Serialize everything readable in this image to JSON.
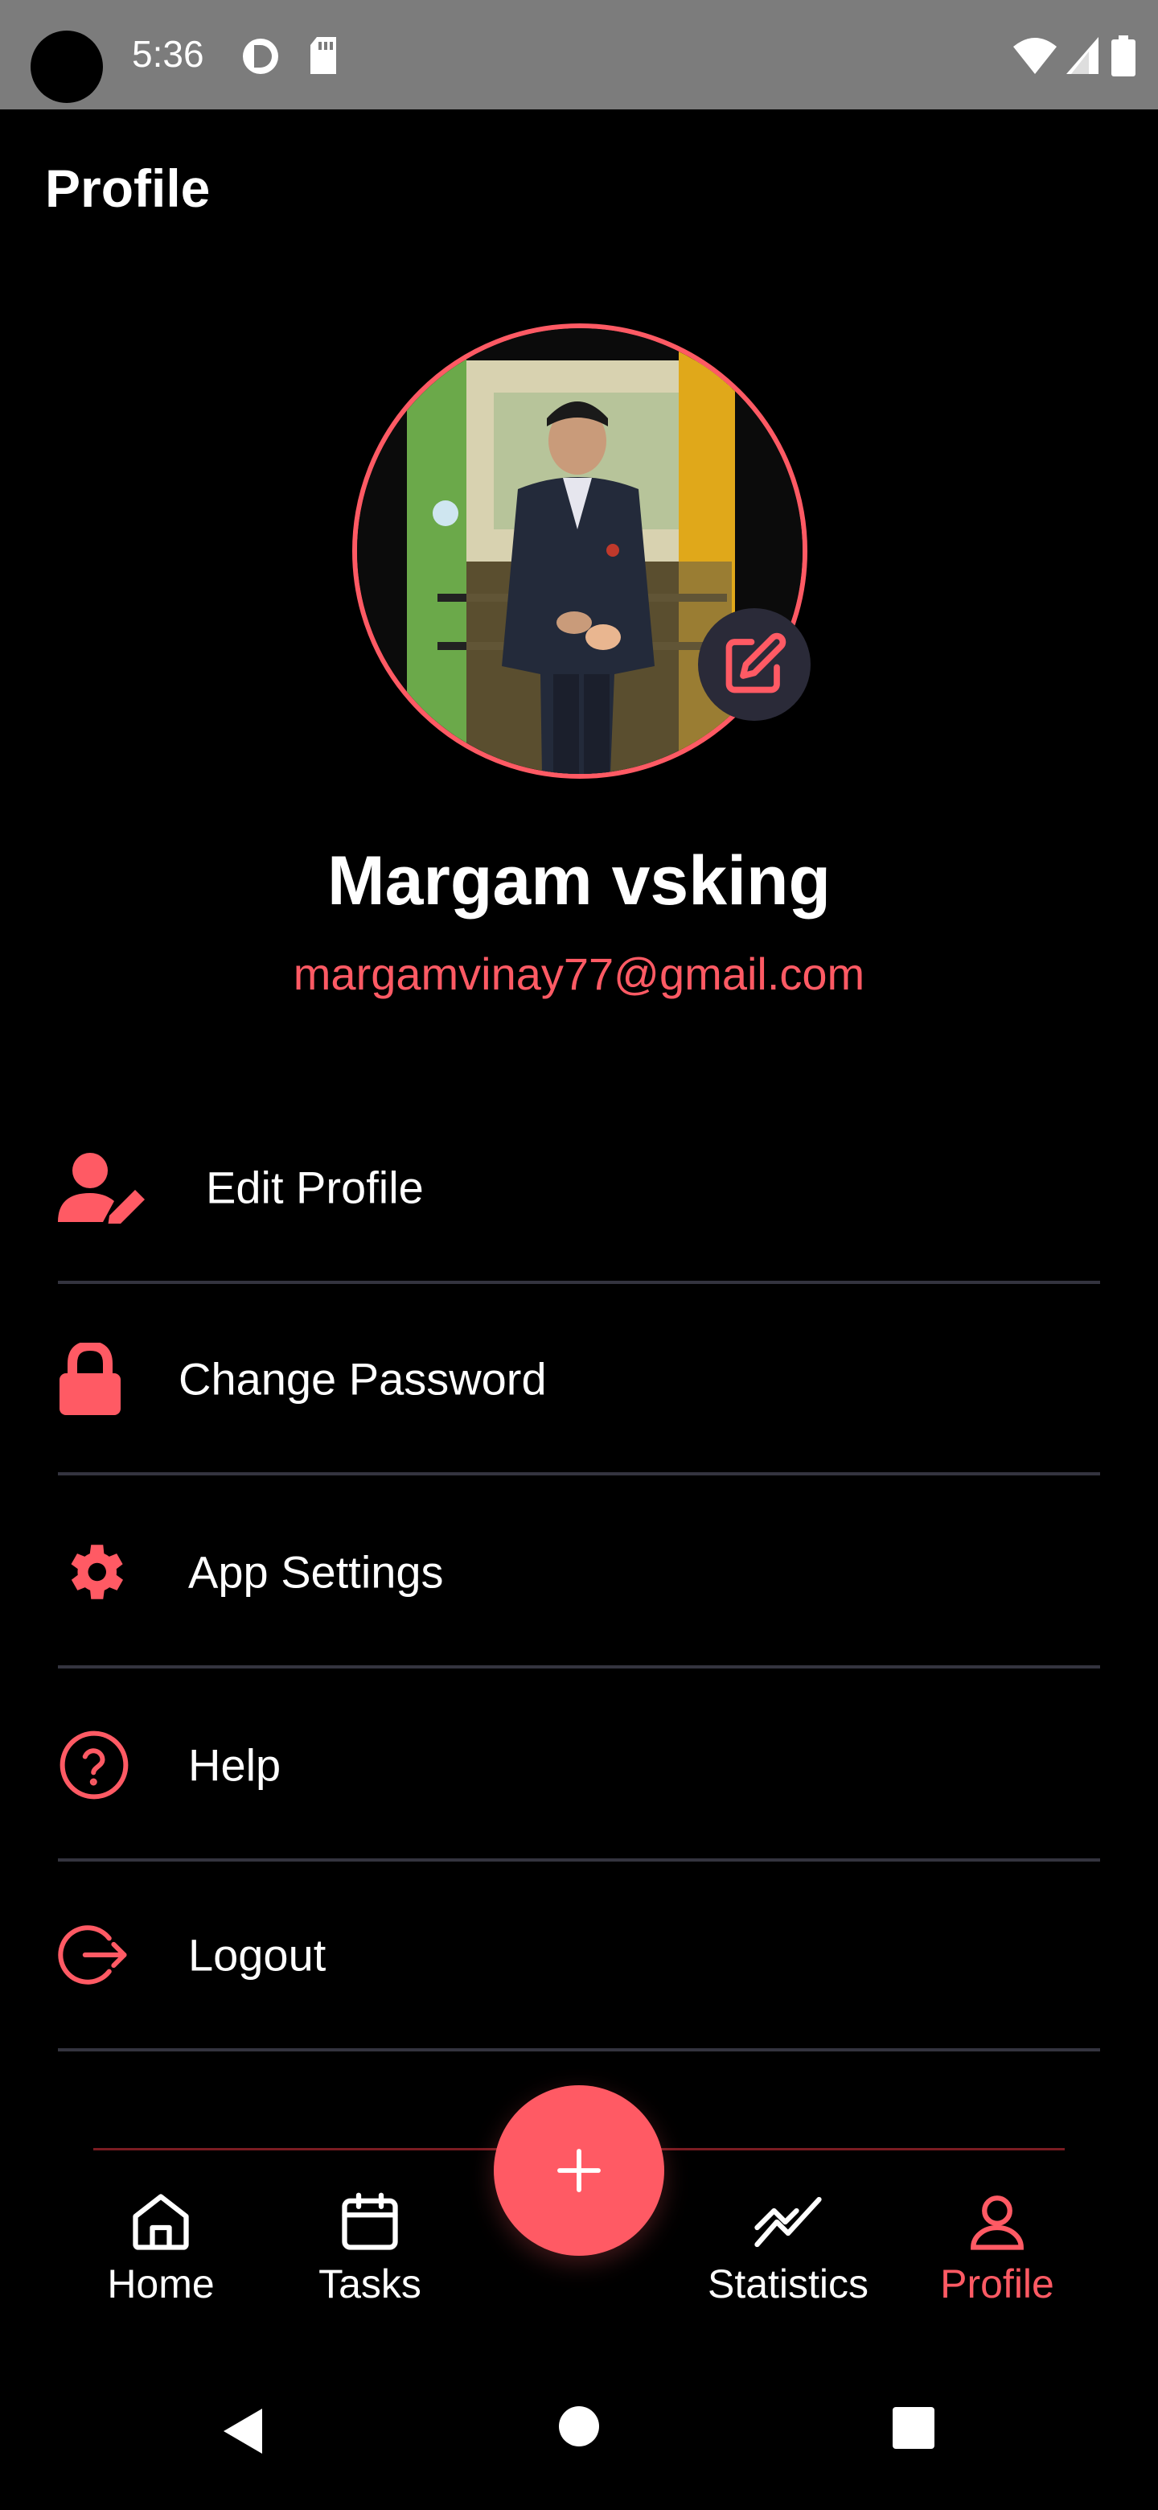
{
  "status_bar": {
    "time": "5:36"
  },
  "header": {
    "title": "Profile"
  },
  "profile": {
    "name": "Margam vsking",
    "email": "margamvinay77@gmail.com"
  },
  "menu": {
    "items": [
      {
        "label": "Edit Profile",
        "icon": "user-edit-icon"
      },
      {
        "label": "Change Password",
        "icon": "lock-icon"
      },
      {
        "label": "App Settings",
        "icon": "gear-icon"
      },
      {
        "label": "Help",
        "icon": "help-circle-icon"
      },
      {
        "label": "Logout",
        "icon": "logout-icon"
      }
    ]
  },
  "bottom_nav": {
    "items": [
      {
        "label": "Home",
        "icon": "home-icon",
        "active": false
      },
      {
        "label": "Tasks",
        "icon": "calendar-icon",
        "active": false
      },
      {
        "label": "Statistics",
        "icon": "chart-line-icon",
        "active": false
      },
      {
        "label": "Profile",
        "icon": "user-icon",
        "active": true
      }
    ],
    "fab_icon": "plus-icon"
  },
  "colors": {
    "accent": "#ff5a64",
    "background": "#000000",
    "divider": "#34343f",
    "status_bar": "#7c7c7c"
  }
}
